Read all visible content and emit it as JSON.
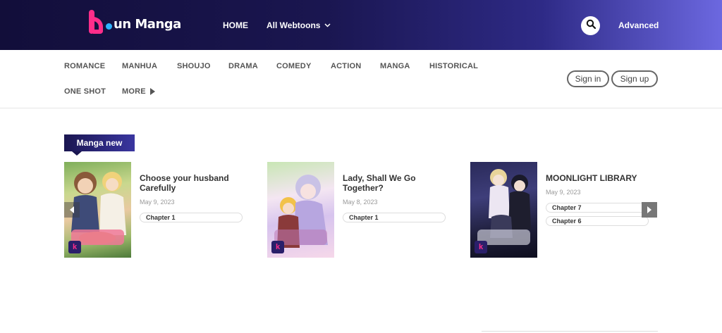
{
  "header": {
    "logo_text": "un Manga",
    "nav": {
      "home": "HOME",
      "all_webtoons": "All Webtoons"
    },
    "advanced": "Advanced",
    "icons": {
      "search": "search-icon",
      "dropdown": "chevron-down-icon"
    },
    "colors": {
      "gradient_start": "#120e3a",
      "gradient_end": "#6c68e0",
      "logo_pink": "#ff2d8a",
      "logo_blue": "#2fb3ff"
    }
  },
  "categories": {
    "row1": [
      "ROMANCE",
      "MANHUA",
      "SHOUJO",
      "DRAMA",
      "COMEDY",
      "ACTION",
      "MANGA",
      "HISTORICAL"
    ],
    "row2": [
      "ONE SHOT",
      "MORE"
    ]
  },
  "auth": {
    "sign_in": "Sign in",
    "sign_up": "Sign up"
  },
  "section": {
    "title": "Manga new"
  },
  "cards": [
    {
      "title": "Choose your husband Carefully",
      "date": "May 9, 2023",
      "chapters": [
        "Chapter 1"
      ]
    },
    {
      "title": "Lady, Shall We Go Together?",
      "date": "May 8, 2023",
      "chapters": [
        "Chapter 1"
      ]
    },
    {
      "title": "MOONLIGHT LIBRARY",
      "date": "May 9, 2023",
      "chapters": [
        "Chapter 7",
        "Chapter 6"
      ]
    }
  ]
}
